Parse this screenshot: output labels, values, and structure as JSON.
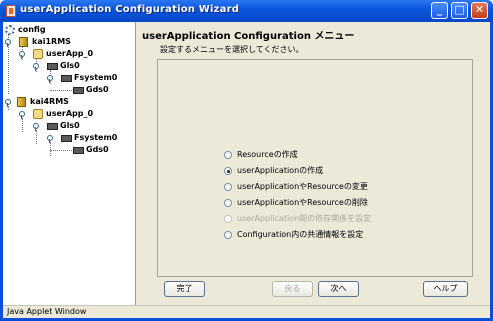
{
  "window": {
    "title": "userApplication Configuration Wizard",
    "minimize_glyph": "_",
    "maximize_glyph": "□",
    "close_glyph": "✕"
  },
  "tree": {
    "nodes": [
      {
        "label": "config",
        "icon": "root-icon"
      },
      {
        "label": "kai1RMS",
        "icon": "host-icon"
      },
      {
        "label": "userApp_0",
        "icon": "app-icon"
      },
      {
        "label": "Gls0",
        "icon": "resource-icon"
      },
      {
        "label": "Fsystem0",
        "icon": "resource-icon"
      },
      {
        "label": "Gds0",
        "icon": "resource-icon"
      },
      {
        "label": "kai4RMS",
        "icon": "host-icon"
      },
      {
        "label": "userApp_0",
        "icon": "app-icon"
      },
      {
        "label": "Gls0",
        "icon": "resource-icon"
      },
      {
        "label": "Fsystem0",
        "icon": "resource-icon"
      },
      {
        "label": "Gds0",
        "icon": "resource-icon"
      }
    ]
  },
  "panel": {
    "title": "userApplication Configuration メニュー",
    "instruction": "設定するメニューを選択してください。",
    "options": [
      {
        "label": "Resourceの作成",
        "selected": false,
        "enabled": true
      },
      {
        "label": "userApplicationの作成",
        "selected": true,
        "enabled": true
      },
      {
        "label": "userApplicationやResourceの変更",
        "selected": false,
        "enabled": true
      },
      {
        "label": "userApplicationやResourceの削除",
        "selected": false,
        "enabled": true
      },
      {
        "label": "userApplication間の依存関係を設定",
        "selected": false,
        "enabled": false
      },
      {
        "label": "Configuration内の共通情報を設定",
        "selected": false,
        "enabled": true
      }
    ]
  },
  "buttons": {
    "finish": "完了",
    "back": "戻る",
    "next": "次へ",
    "help": "ヘルプ"
  },
  "status": {
    "text": "Java Applet Window"
  }
}
